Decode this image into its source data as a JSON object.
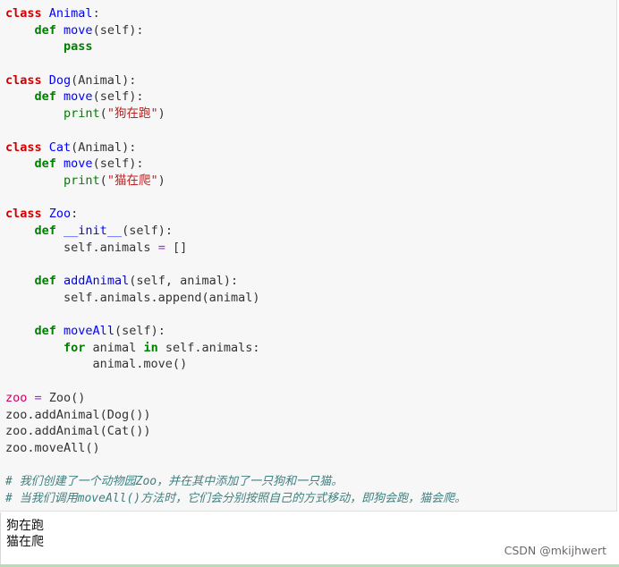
{
  "code": {
    "lines": [
      [
        {
          "t": "class",
          "c": "cls"
        },
        {
          "t": " ",
          "c": ""
        },
        {
          "t": "Animal",
          "c": "cname"
        },
        {
          "t": ":",
          "c": ""
        }
      ],
      [
        {
          "t": "    ",
          "c": ""
        },
        {
          "t": "def",
          "c": "def"
        },
        {
          "t": " ",
          "c": ""
        },
        {
          "t": "move",
          "c": "fn"
        },
        {
          "t": "(self):",
          "c": ""
        }
      ],
      [
        {
          "t": "        ",
          "c": ""
        },
        {
          "t": "pass",
          "c": "kw"
        }
      ],
      [],
      [
        {
          "t": "class",
          "c": "cls"
        },
        {
          "t": " ",
          "c": ""
        },
        {
          "t": "Dog",
          "c": "cname"
        },
        {
          "t": "(Animal):",
          "c": ""
        }
      ],
      [
        {
          "t": "    ",
          "c": ""
        },
        {
          "t": "def",
          "c": "def"
        },
        {
          "t": " ",
          "c": ""
        },
        {
          "t": "move",
          "c": "fn"
        },
        {
          "t": "(self):",
          "c": ""
        }
      ],
      [
        {
          "t": "        ",
          "c": ""
        },
        {
          "t": "print",
          "c": "builtin"
        },
        {
          "t": "(",
          "c": ""
        },
        {
          "t": "\"狗在跑\"",
          "c": "str"
        },
        {
          "t": ")",
          "c": ""
        }
      ],
      [],
      [
        {
          "t": "class",
          "c": "cls"
        },
        {
          "t": " ",
          "c": ""
        },
        {
          "t": "Cat",
          "c": "cname"
        },
        {
          "t": "(Animal):",
          "c": ""
        }
      ],
      [
        {
          "t": "    ",
          "c": ""
        },
        {
          "t": "def",
          "c": "def"
        },
        {
          "t": " ",
          "c": ""
        },
        {
          "t": "move",
          "c": "fn"
        },
        {
          "t": "(self):",
          "c": ""
        }
      ],
      [
        {
          "t": "        ",
          "c": ""
        },
        {
          "t": "print",
          "c": "builtin"
        },
        {
          "t": "(",
          "c": ""
        },
        {
          "t": "\"猫在爬\"",
          "c": "str"
        },
        {
          "t": ")",
          "c": ""
        }
      ],
      [],
      [
        {
          "t": "class",
          "c": "cls"
        },
        {
          "t": " ",
          "c": ""
        },
        {
          "t": "Zoo",
          "c": "cname"
        },
        {
          "t": ":",
          "c": ""
        }
      ],
      [
        {
          "t": "    ",
          "c": ""
        },
        {
          "t": "def",
          "c": "def"
        },
        {
          "t": " ",
          "c": ""
        },
        {
          "t": "__init__",
          "c": "fn"
        },
        {
          "t": "(self):",
          "c": ""
        }
      ],
      [
        {
          "t": "        self.animals ",
          "c": ""
        },
        {
          "t": "=",
          "c": "op"
        },
        {
          "t": " []",
          "c": ""
        }
      ],
      [],
      [
        {
          "t": "    ",
          "c": ""
        },
        {
          "t": "def",
          "c": "def"
        },
        {
          "t": " ",
          "c": ""
        },
        {
          "t": "addAnimal",
          "c": "fn"
        },
        {
          "t": "(self, animal):",
          "c": ""
        }
      ],
      [
        {
          "t": "        self.animals.append(animal)",
          "c": ""
        }
      ],
      [],
      [
        {
          "t": "    ",
          "c": ""
        },
        {
          "t": "def",
          "c": "def"
        },
        {
          "t": " ",
          "c": ""
        },
        {
          "t": "moveAll",
          "c": "fn"
        },
        {
          "t": "(self):",
          "c": ""
        }
      ],
      [
        {
          "t": "        ",
          "c": ""
        },
        {
          "t": "for",
          "c": "kw"
        },
        {
          "t": " animal ",
          "c": ""
        },
        {
          "t": "in",
          "c": "kw"
        },
        {
          "t": " self.animals:",
          "c": ""
        }
      ],
      [
        {
          "t": "            animal.move()",
          "c": ""
        }
      ],
      [],
      [
        {
          "t": "zoo",
          "c": "var"
        },
        {
          "t": " ",
          "c": ""
        },
        {
          "t": "=",
          "c": "op"
        },
        {
          "t": " Zoo()",
          "c": ""
        }
      ],
      [
        {
          "t": "zoo.addAnimal(Dog())",
          "c": ""
        }
      ],
      [
        {
          "t": "zoo.addAnimal(Cat())",
          "c": ""
        }
      ],
      [
        {
          "t": "zoo.moveAll()",
          "c": ""
        }
      ],
      [],
      [
        {
          "t": "# 我们创建了一个动物园Zoo，并在其中添加了一只狗和一只猫。",
          "c": "cm"
        }
      ],
      [
        {
          "t": "# 当我们调用moveAll()方法时，它们会分别按照自己的方式移动，即狗会跑，猫会爬。",
          "c": "cm"
        }
      ]
    ]
  },
  "output": {
    "lines": [
      "狗在跑",
      "猫在爬"
    ]
  },
  "watermark": "CSDN @mkijhwert"
}
